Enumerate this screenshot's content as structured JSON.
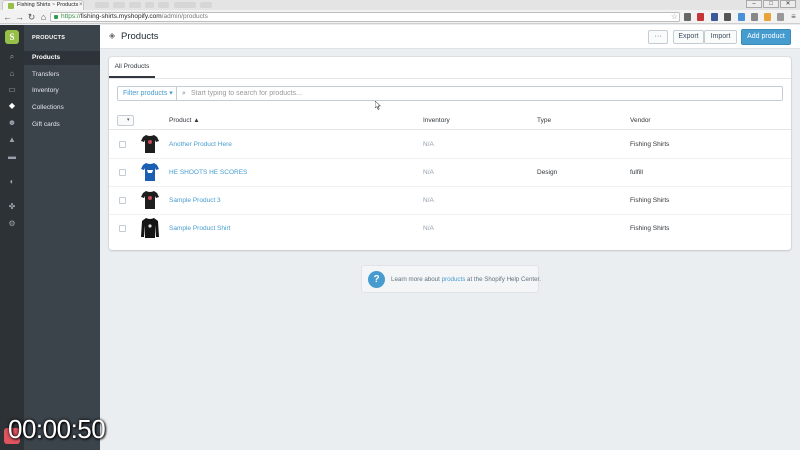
{
  "browser": {
    "tab_title": "Fishing Shirts ~ Products",
    "tab_close": "×",
    "url_scheme": "https://",
    "url_host": "fishing-shirts.myshopify.com",
    "url_path": "/admin/products",
    "back_icon": "arrow-left-icon",
    "forward_icon": "arrow-right-icon",
    "reload_icon": "reload-icon",
    "home_icon": "home-icon",
    "window_minimize": "–",
    "window_maximize": "□",
    "window_close": "✕"
  },
  "shopify_sidebar": {
    "logo_letter": "S",
    "icons": [
      "search-icon",
      "home-icon",
      "orders-icon",
      "products-icon",
      "customers-icon",
      "reports-icon",
      "discounts-icon",
      "online-store-icon",
      "apps-icon",
      "settings-icon"
    ]
  },
  "subnav": {
    "title": "PRODUCTS",
    "items": [
      {
        "label": "Products",
        "active": true
      },
      {
        "label": "Transfers",
        "active": false
      },
      {
        "label": "Inventory",
        "active": false
      },
      {
        "label": "Collections",
        "active": false
      },
      {
        "label": "Gift cards",
        "active": false
      }
    ]
  },
  "header": {
    "title": "Products",
    "more_label": "···",
    "export_label": "Export",
    "import_label": "Import",
    "add_label": "Add product"
  },
  "tabs": [
    {
      "label": "All Products",
      "active": true
    }
  ],
  "filter": {
    "button_label": "Filter products ▾",
    "search_placeholder": "Start typing to search for products..."
  },
  "table": {
    "columns": {
      "product": "Product ▲",
      "inventory": "Inventory",
      "type": "Type",
      "vendor": "Vendor"
    },
    "bulk_caret": "▾",
    "rows": [
      {
        "name": "Another Product Here",
        "inventory": "N/A",
        "type": "",
        "vendor": "Fishing Shirts",
        "shirt_color": "#1e1e1e"
      },
      {
        "name": "HE SHOOTS HE SCORES",
        "inventory": "N/A",
        "type": "Design",
        "vendor": "fulfill",
        "shirt_color": "#1a5fb4"
      },
      {
        "name": "Sample Product 3",
        "inventory": "N/A",
        "type": "",
        "vendor": "Fishing Shirts",
        "shirt_color": "#1e1e1e"
      },
      {
        "name": "Sample Product Shirt",
        "inventory": "N/A",
        "type": "",
        "vendor": "Fishing Shirts",
        "shirt_color": "#151515"
      }
    ]
  },
  "help": {
    "icon": "?",
    "prefix": "Learn more about ",
    "link": "products",
    "suffix": " at the Shopify Help Center."
  },
  "overlay": {
    "timer": "00:00:50"
  },
  "colors": {
    "accent": "#479ccf",
    "brand": "#95bf47",
    "sidebar": "#2d3237",
    "subnav": "#3b434b"
  }
}
